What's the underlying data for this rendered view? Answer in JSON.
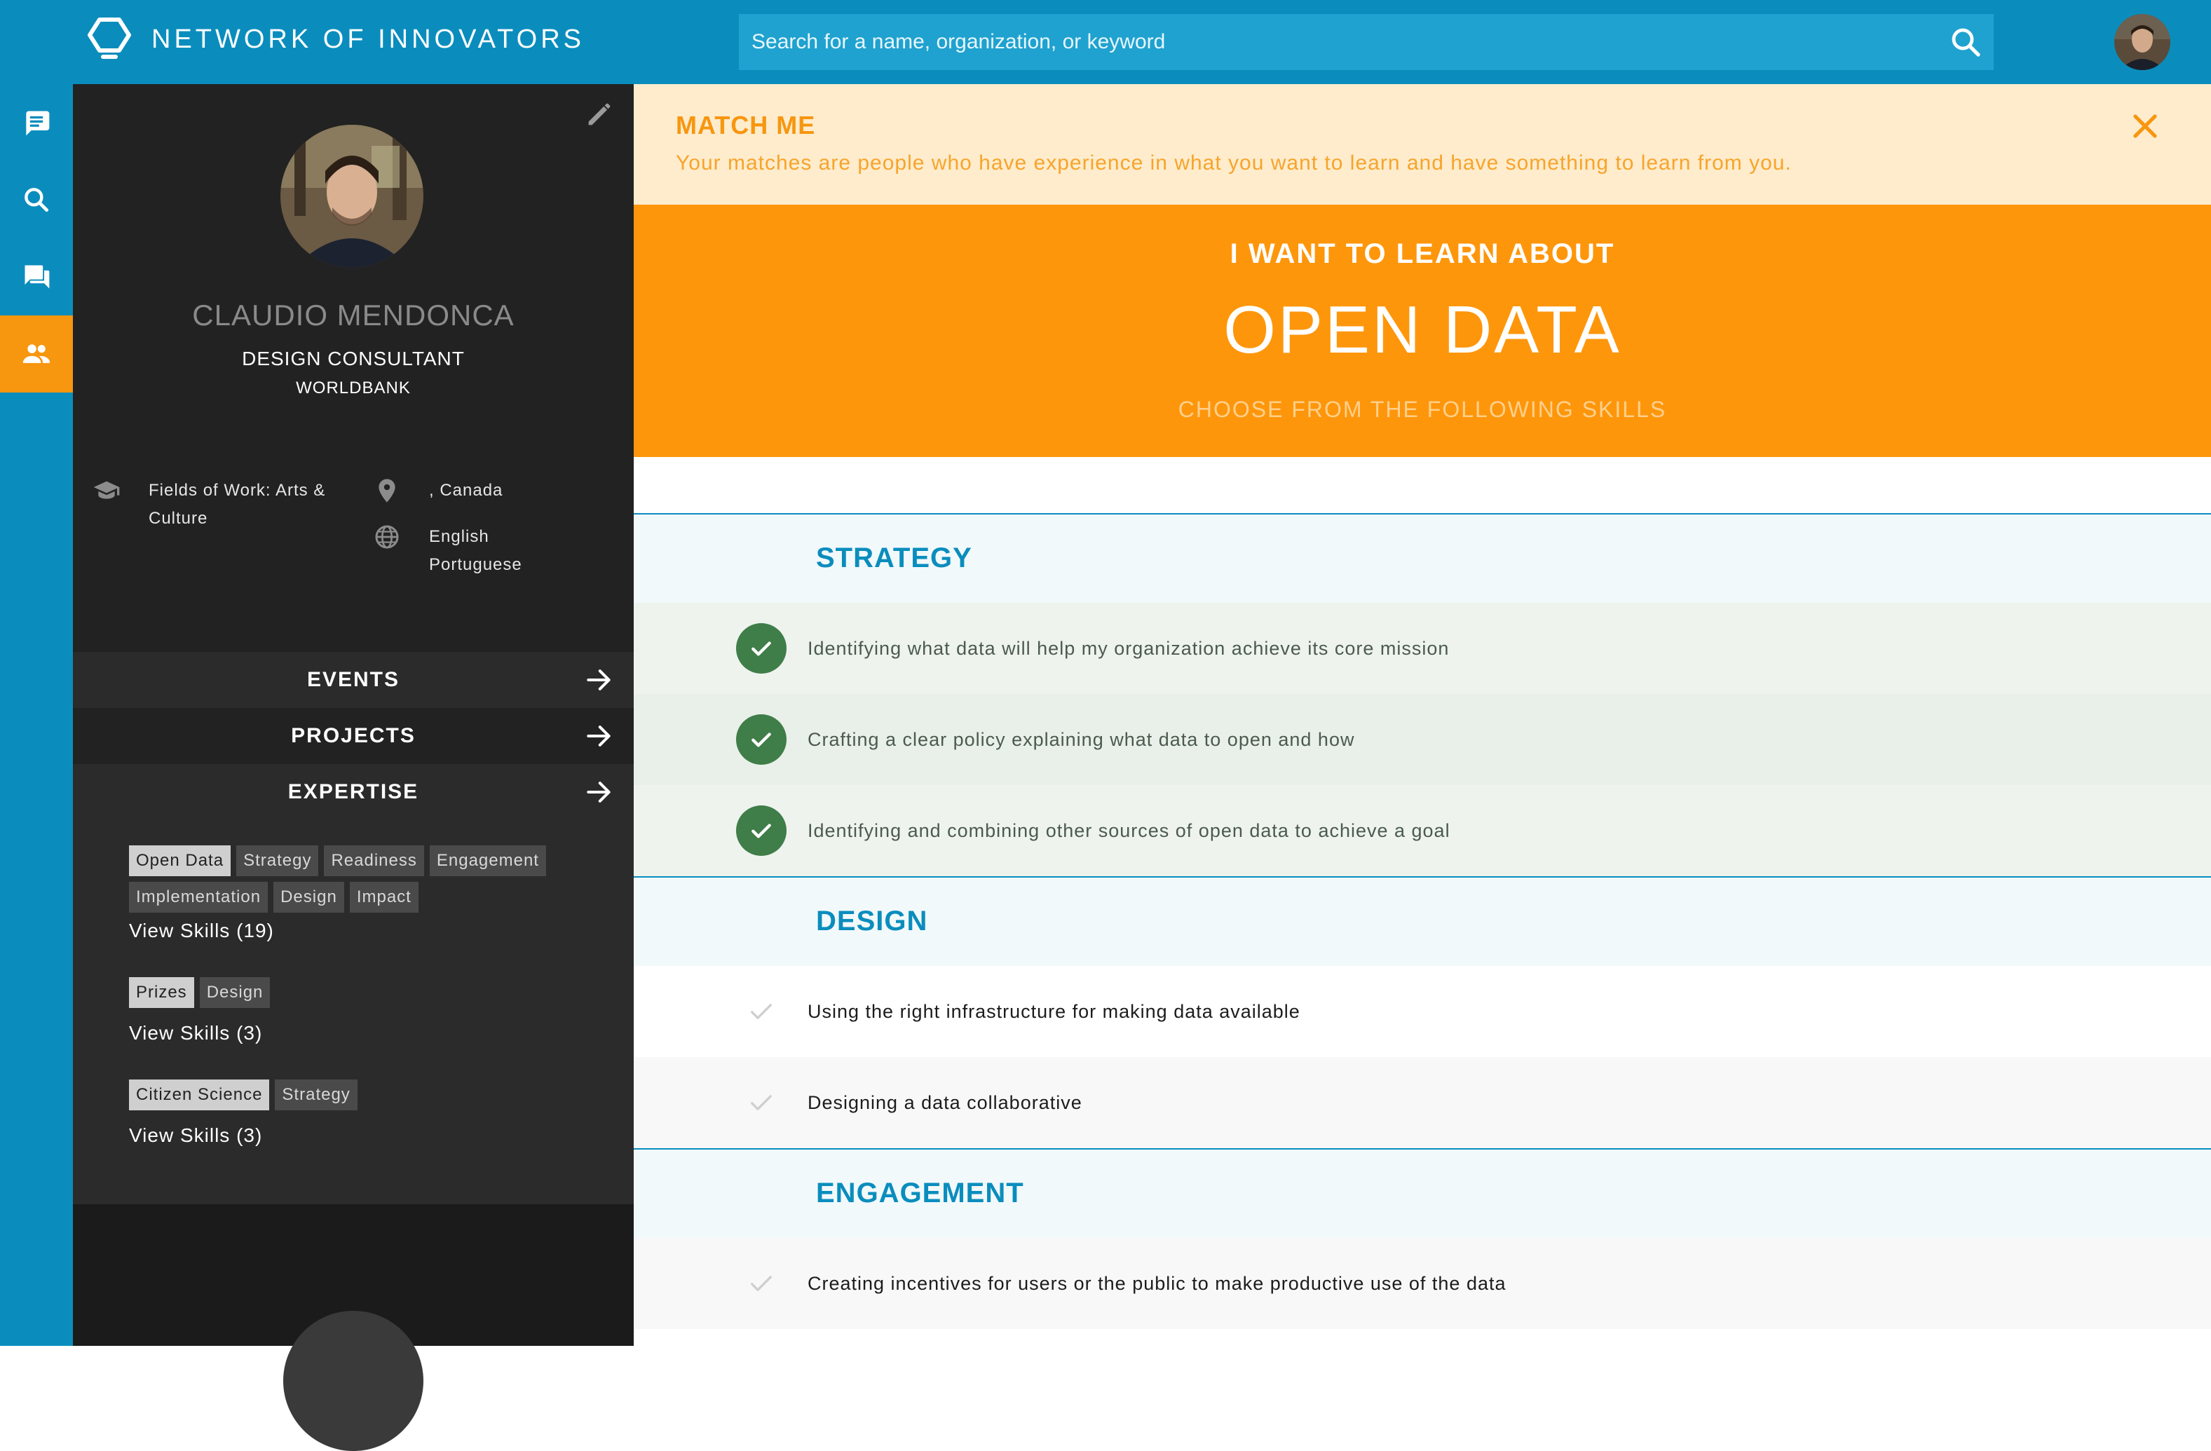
{
  "app": {
    "title": "NETWORK OF INNOVATORS",
    "search_placeholder": "Search for a name, organization, or keyword"
  },
  "rail": {
    "items": [
      {
        "name": "messages",
        "icon": "message-icon",
        "active": false
      },
      {
        "name": "search",
        "icon": "search-icon",
        "active": false
      },
      {
        "name": "forum",
        "icon": "chat-icon",
        "active": false
      },
      {
        "name": "people",
        "icon": "people-icon",
        "active": true
      }
    ]
  },
  "profile": {
    "name": "CLAUDIO MENDONCA",
    "role": "DESIGN CONSULTANT",
    "organization": "WORLDBANK",
    "fields_of_work": "Fields of Work: Arts & Culture",
    "location": ", Canada",
    "languages": [
      "English",
      "Portuguese"
    ]
  },
  "nav": {
    "events": "EVENTS",
    "projects": "PROJECTS",
    "expertise": "EXPERTISE"
  },
  "expertise": [
    {
      "tags": [
        "Open Data",
        "Strategy",
        "Readiness",
        "Engagement",
        "Implementation",
        "Design",
        "Impact"
      ],
      "view": "View Skills (19)"
    },
    {
      "tags": [
        "Prizes",
        "Design"
      ],
      "view": "View Skills (3)"
    },
    {
      "tags": [
        "Citizen Science",
        "Strategy"
      ],
      "view": "View Skills (3)"
    }
  ],
  "banner": {
    "title": "MATCH ME",
    "text": "Your matches are people who have experience in what you want to learn and have something to learn from you."
  },
  "hero": {
    "kicker": "I WANT TO LEARN ABOUT",
    "topic": "OPEN DATA",
    "subtitle": "CHOOSE FROM THE FOLLOWING SKILLS"
  },
  "sections": [
    {
      "title": "STRATEGY",
      "skills": [
        {
          "label": "Identifying what data will help my organization achieve its core mission",
          "checked": true
        },
        {
          "label": "Crafting a clear policy explaining what data to open and how",
          "checked": true
        },
        {
          "label": "Identifying and combining other sources of open data to achieve a goal",
          "checked": true
        }
      ]
    },
    {
      "title": "DESIGN",
      "skills": [
        {
          "label": "Using the right infrastructure for making data available",
          "checked": false
        },
        {
          "label": "Designing a data collaborative",
          "checked": false
        }
      ]
    },
    {
      "title": "ENGAGEMENT",
      "skills": [
        {
          "label": "Creating incentives for users or the public to make productive use of the data",
          "checked": false
        }
      ]
    }
  ],
  "colors": {
    "brand_blue": "#0a8dbd",
    "accent_orange": "#fe960b",
    "check_green": "#3f7d49",
    "panel_dark": "#222222"
  }
}
